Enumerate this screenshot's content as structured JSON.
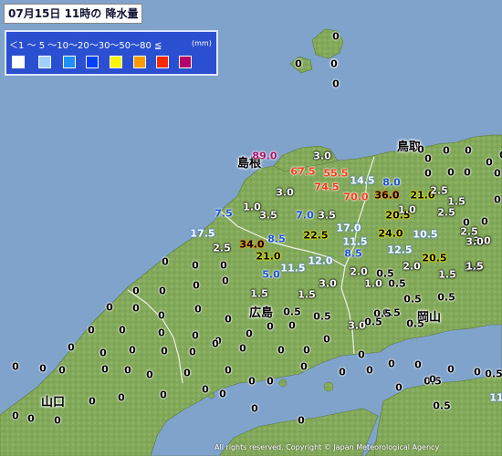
{
  "header": {
    "title": "07月15日 11時の 降水量"
  },
  "legend": {
    "scale": "＜1 〜 5 〜10〜20〜30〜50〜80 ≦",
    "unit": "(mm)",
    "swatches": [
      {
        "color": "#ffffff"
      },
      {
        "color": "#a0d2ff"
      },
      {
        "color": "#2190ff"
      },
      {
        "color": "#0041ff"
      },
      {
        "color": "#faf500"
      },
      {
        "color": "#ff9900"
      },
      {
        "color": "#ff2800"
      },
      {
        "color": "#b40068"
      }
    ]
  },
  "prefectures": [
    {
      "id": "shimane",
      "name": "島根"
    },
    {
      "id": "tottori",
      "name": "鳥取"
    },
    {
      "id": "hiroshima",
      "name": "広島"
    },
    {
      "id": "okayama",
      "name": "岡山"
    },
    {
      "id": "yamaguchi",
      "name": "山口"
    }
  ],
  "observations": [
    {
      "value": "0"
    },
    {
      "value": "0"
    },
    {
      "value": "0"
    },
    {
      "value": "89.0"
    },
    {
      "value": "3.0"
    },
    {
      "value": "67.5"
    },
    {
      "value": "55.5"
    },
    {
      "value": "74.5"
    },
    {
      "value": "14.5"
    },
    {
      "value": "8.0"
    },
    {
      "value": "70.0"
    },
    {
      "value": "36.0"
    },
    {
      "value": "21.0"
    },
    {
      "value": "2.5"
    },
    {
      "value": "1.5"
    },
    {
      "value": "3.0"
    },
    {
      "value": "1.0"
    },
    {
      "value": "3.5"
    },
    {
      "value": "7.5"
    },
    {
      "value": "7.0"
    },
    {
      "value": "3.5"
    },
    {
      "value": "17.0"
    },
    {
      "value": "20.5"
    },
    {
      "value": "17.5"
    },
    {
      "value": "8.5"
    },
    {
      "value": "22.5"
    },
    {
      "value": "24.0"
    },
    {
      "value": "10.5"
    },
    {
      "value": "2.5"
    },
    {
      "value": "34.0"
    },
    {
      "value": "21.0"
    },
    {
      "value": "11.5"
    },
    {
      "value": "8.5"
    },
    {
      "value": "12.5"
    },
    {
      "value": "20.5"
    },
    {
      "value": "11.5"
    },
    {
      "value": "12.0"
    },
    {
      "value": "5.0"
    },
    {
      "value": "2.0"
    },
    {
      "value": "0.5"
    },
    {
      "value": "2.0"
    },
    {
      "value": "1.5"
    },
    {
      "value": "3.5"
    },
    {
      "value": "3.0"
    },
    {
      "value": "1.0"
    },
    {
      "value": "0.5"
    },
    {
      "value": "1.5"
    },
    {
      "value": "1.5"
    },
    {
      "value": "3.0"
    },
    {
      "value": "0.5"
    },
    {
      "value": "0.5"
    },
    {
      "value": "0.5"
    },
    {
      "value": "0.5"
    },
    {
      "value": "0.5"
    },
    {
      "value": "3.0"
    },
    {
      "value": "0.5"
    },
    {
      "value": "0.5"
    },
    {
      "value": "0.5"
    },
    {
      "value": "2.5"
    },
    {
      "value": "3.0"
    },
    {
      "value": "2.5"
    },
    {
      "value": "1.0"
    },
    {
      "value": "1.5"
    },
    {
      "value": "0.5"
    },
    {
      "value": "0.5"
    },
    {
      "value": "0.5"
    },
    {
      "value": "11"
    },
    {
      "value": "0"
    },
    {
      "value": "0"
    },
    {
      "value": "0"
    },
    {
      "value": "0"
    },
    {
      "value": "0"
    },
    {
      "value": "0"
    },
    {
      "value": "0"
    },
    {
      "value": "0"
    },
    {
      "value": "0"
    },
    {
      "value": "0"
    },
    {
      "value": "0"
    },
    {
      "value": "0"
    },
    {
      "value": "0"
    },
    {
      "value": "0"
    },
    {
      "value": "0"
    },
    {
      "value": "0"
    },
    {
      "value": "0"
    },
    {
      "value": "0"
    },
    {
      "value": "0"
    },
    {
      "value": "0"
    },
    {
      "value": "0"
    },
    {
      "value": "0"
    },
    {
      "value": "0"
    },
    {
      "value": "0"
    },
    {
      "value": "0"
    },
    {
      "value": "0"
    },
    {
      "value": "0"
    },
    {
      "value": "0"
    },
    {
      "value": "0"
    },
    {
      "value": "0"
    },
    {
      "value": "0"
    },
    {
      "value": "0"
    },
    {
      "value": "0"
    },
    {
      "value": "0"
    },
    {
      "value": "0"
    },
    {
      "value": "0"
    },
    {
      "value": "0"
    },
    {
      "value": "0"
    },
    {
      "value": "0"
    },
    {
      "value": "0"
    },
    {
      "value": "0"
    },
    {
      "value": "0"
    },
    {
      "value": "0"
    },
    {
      "value": "0"
    },
    {
      "value": "0"
    },
    {
      "value": "0"
    },
    {
      "value": "0"
    },
    {
      "value": "0"
    },
    {
      "value": "0"
    },
    {
      "value": "0"
    },
    {
      "value": "0"
    },
    {
      "value": "0"
    },
    {
      "value": "0"
    },
    {
      "value": "0"
    },
    {
      "value": "0"
    },
    {
      "value": "0"
    },
    {
      "value": "0"
    },
    {
      "value": "0"
    },
    {
      "value": "0"
    },
    {
      "value": "0"
    },
    {
      "value": "0"
    },
    {
      "value": "0"
    },
    {
      "value": "0"
    },
    {
      "value": "0"
    },
    {
      "value": "0"
    },
    {
      "value": "0"
    },
    {
      "value": "0"
    },
    {
      "value": "0"
    },
    {
      "value": "0"
    },
    {
      "value": "0"
    },
    {
      "value": "0"
    },
    {
      "value": "0"
    },
    {
      "value": "0"
    },
    {
      "value": "0"
    },
    {
      "value": "0"
    },
    {
      "value": "0"
    },
    {
      "value": "0"
    },
    {
      "value": "0"
    }
  ],
  "footer": {
    "copyright": "All rights reserved. Copyright © Japan Meteorological Agency"
  }
}
